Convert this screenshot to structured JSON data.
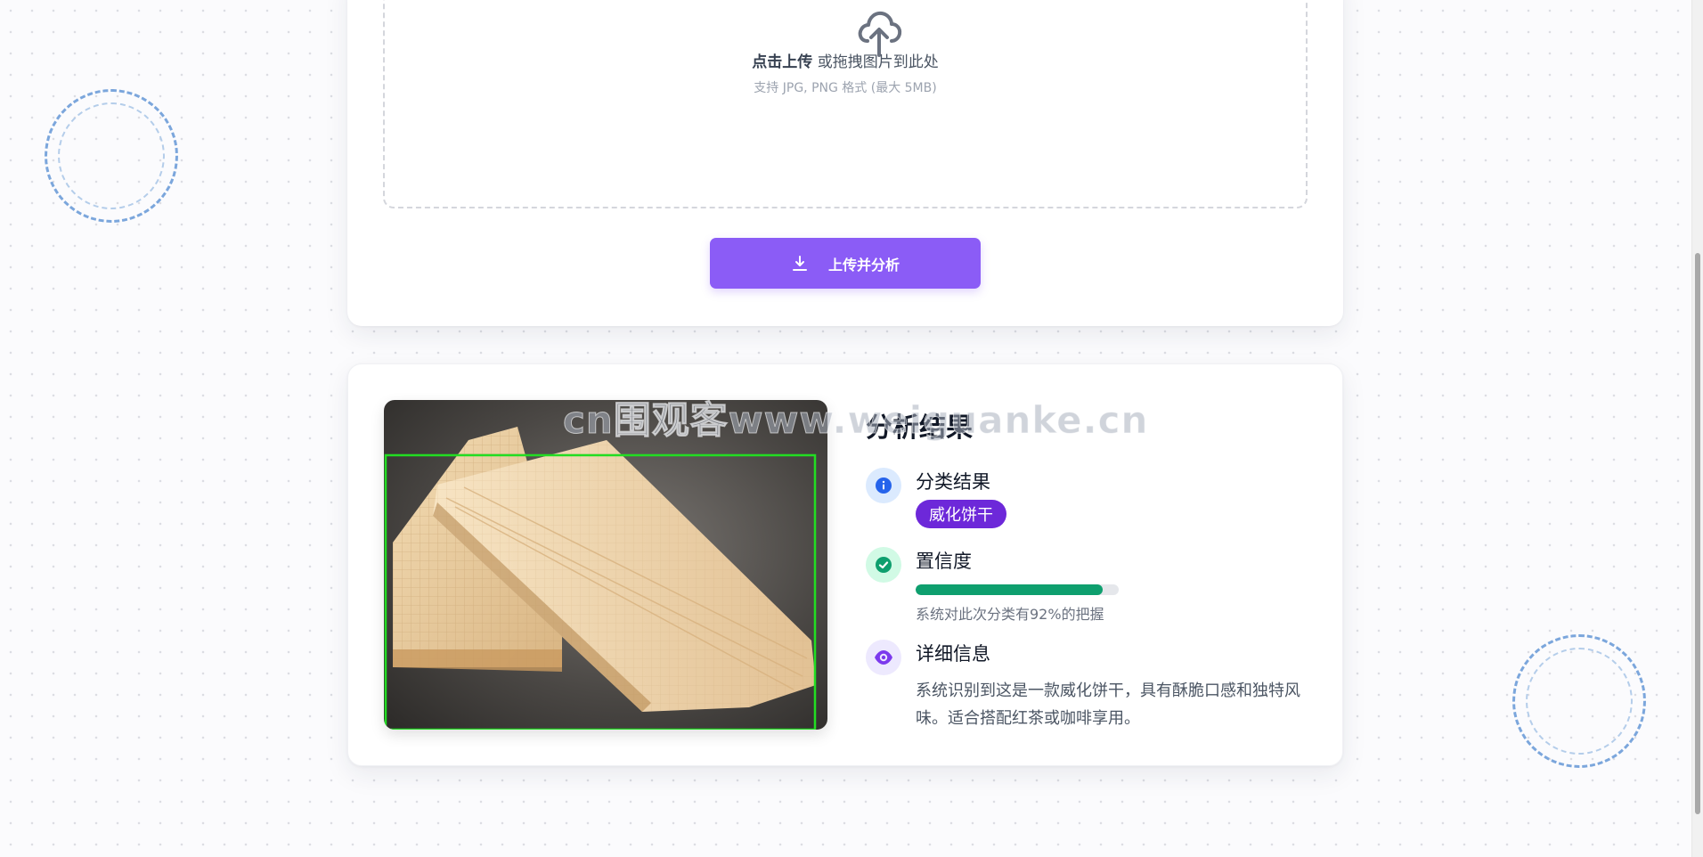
{
  "upload": {
    "drop_strong": "点击上传",
    "drop_text": " 或拖拽图片到此处",
    "hint": "支持 JPG, PNG 格式 (最大 5MB)",
    "button_label": "上传并分析"
  },
  "result": {
    "title": "分析结果",
    "classification_label": "分类结果",
    "classification_value": "威化饼干",
    "confidence_label": "置信度",
    "confidence_value": 0.92,
    "confidence_text": "系统对此次分类有92%的把握",
    "detail_label": "详细信息",
    "detail_text": "系统识别到这是一款威化饼干，具有酥脆口感和独特风味。适合搭配红茶或咖啡享用。"
  },
  "watermark": "cn围观客www.weiguanke.cn",
  "colors": {
    "accent": "#8b5cf6",
    "chip": "#6d28d9",
    "success": "#0e9f6e",
    "info": "#2563eb",
    "detection_box": "#22dd22"
  },
  "icons": {
    "upload": "cloud-upload-icon",
    "button": "download-icon",
    "classification": "info-circle-icon",
    "confidence": "check-circle-icon",
    "detail": "eye-icon"
  }
}
